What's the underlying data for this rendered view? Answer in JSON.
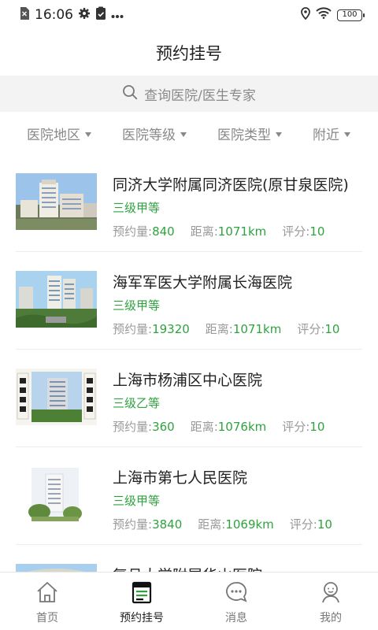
{
  "status": {
    "time": "16:06",
    "battery": "100"
  },
  "title": "预约挂号",
  "search": {
    "placeholder": "查询医院/医生专家"
  },
  "filters": [
    {
      "label": "医院地区"
    },
    {
      "label": "医院等级"
    },
    {
      "label": "医院类型"
    },
    {
      "label": "附近"
    }
  ],
  "hospitals": [
    {
      "name": "同济大学附属同济医院(原甘泉医院)",
      "level": "三级甲等",
      "appt_label": "预约量:",
      "appt": "840",
      "dist_label": "距离:",
      "dist": "1071km",
      "score_label": "评分:",
      "score": "10"
    },
    {
      "name": "海军军医大学附属长海医院",
      "level": "三级甲等",
      "appt_label": "预约量:",
      "appt": "19320",
      "dist_label": "距离:",
      "dist": "1071km",
      "score_label": "评分:",
      "score": "10"
    },
    {
      "name": "上海市杨浦区中心医院",
      "level": "三级乙等",
      "appt_label": "预约量:",
      "appt": "360",
      "dist_label": "距离:",
      "dist": "1076km",
      "score_label": "评分:",
      "score": "10"
    },
    {
      "name": "上海市第七人民医院",
      "level": "三级甲等",
      "appt_label": "预约量:",
      "appt": "3840",
      "dist_label": "距离:",
      "dist": "1069km",
      "score_label": "评分:",
      "score": "10"
    },
    {
      "name": "复旦大学附属华山医院",
      "level": "",
      "appt_label": "",
      "appt": "",
      "dist_label": "",
      "dist": "",
      "score_label": "",
      "score": ""
    }
  ],
  "tabs": [
    {
      "label": "首页"
    },
    {
      "label": "预约挂号"
    },
    {
      "label": "消息"
    },
    {
      "label": "我的"
    }
  ],
  "colors": {
    "accent": "#2ea33e",
    "muted": "#9a9a9a"
  }
}
